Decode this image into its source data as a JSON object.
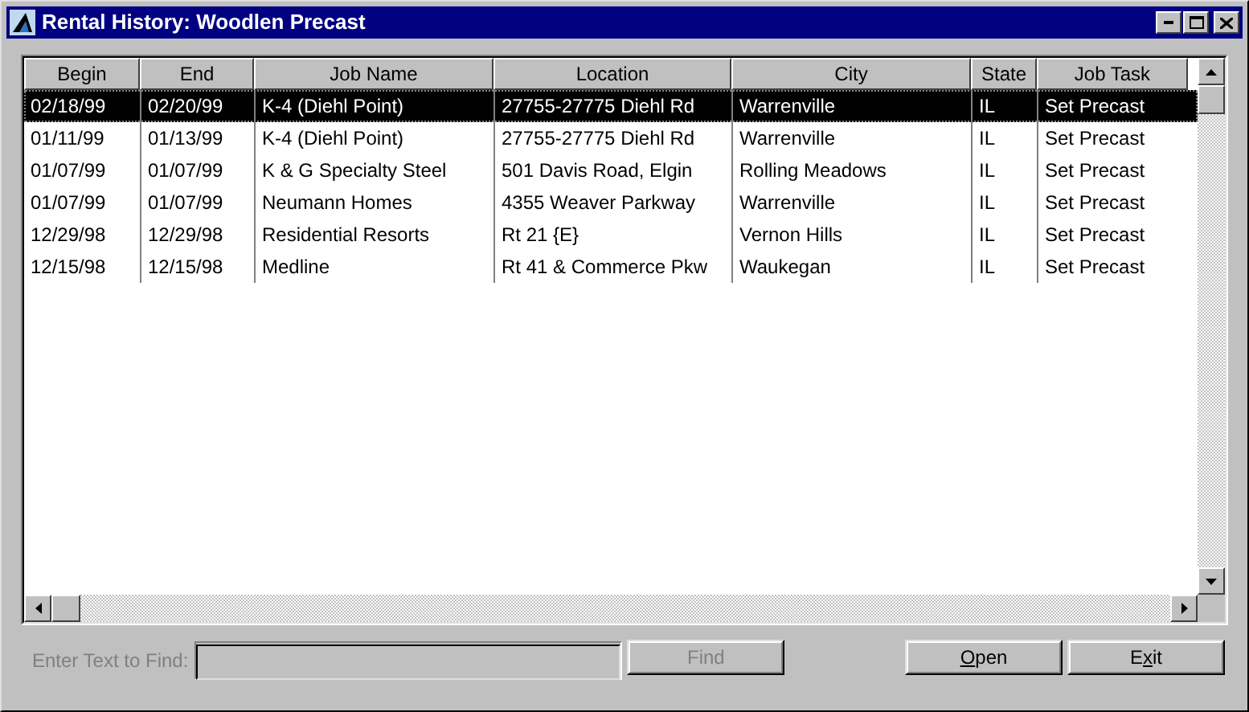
{
  "window": {
    "title": "Rental History: Woodlen Precast"
  },
  "table": {
    "columns": [
      "Begin",
      "End",
      "Job Name",
      "Location",
      "City",
      "State",
      "Job Task"
    ],
    "rows": [
      {
        "selected": true,
        "cells": [
          "02/18/99",
          "02/20/99",
          "K-4 (Diehl Point)",
          "27755-27775 Diehl Rd",
          "Warrenville",
          "IL",
          "Set Precast"
        ]
      },
      {
        "selected": false,
        "cells": [
          "01/11/99",
          "01/13/99",
          "K-4 (Diehl Point)",
          "27755-27775 Diehl Rd",
          "Warrenville",
          "IL",
          "Set Precast"
        ]
      },
      {
        "selected": false,
        "cells": [
          "01/07/99",
          "01/07/99",
          "K & G Specialty Steel",
          "501 Davis Road, Elgin",
          "Rolling Meadows",
          "IL",
          "Set Precast"
        ]
      },
      {
        "selected": false,
        "cells": [
          "01/07/99",
          "01/07/99",
          "Neumann Homes",
          "4355 Weaver Parkway",
          "Warrenville",
          "IL",
          "Set Precast"
        ]
      },
      {
        "selected": false,
        "cells": [
          "12/29/98",
          "12/29/98",
          "Residential Resorts",
          "Rt 21 {E}",
          "Vernon Hills",
          "IL",
          "Set Precast"
        ]
      },
      {
        "selected": false,
        "cells": [
          "12/15/98",
          "12/15/98",
          "Medline",
          "Rt 41 & Commerce Pkw",
          "Waukegan",
          "IL",
          "Set Precast"
        ]
      }
    ]
  },
  "find": {
    "label": "Enter Text to Find:",
    "disabled": true,
    "button": "Find"
  },
  "buttons": [
    {
      "parts": [
        {
          "text": "O",
          "underline": true
        },
        {
          "text": "pen",
          "underline": false
        }
      ]
    },
    {
      "parts": [
        {
          "text": "E",
          "underline": false
        },
        {
          "text": "x",
          "underline": true
        },
        {
          "text": "it",
          "underline": false
        }
      ]
    }
  ]
}
